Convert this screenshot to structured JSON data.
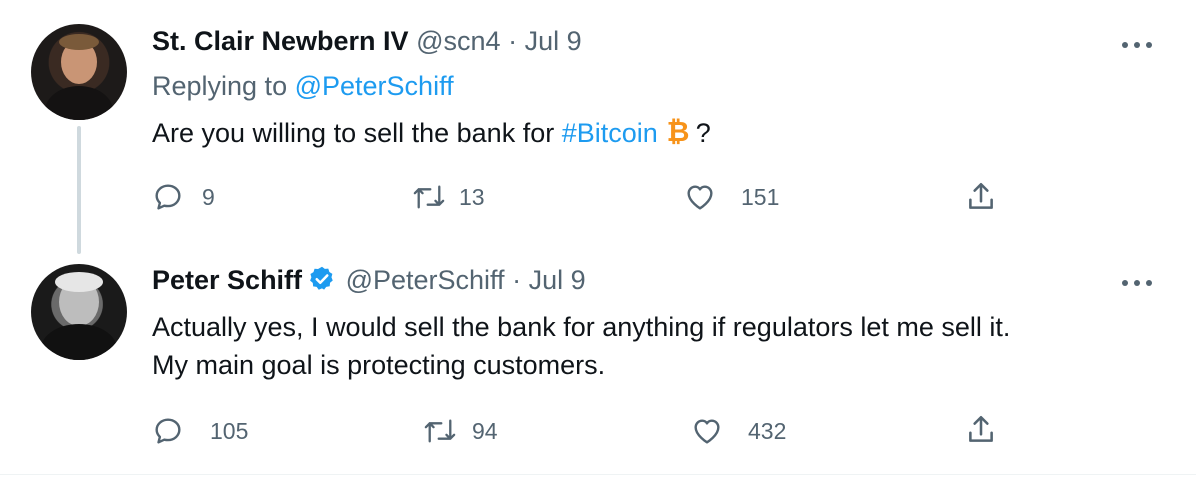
{
  "tweets": [
    {
      "name": "St. Clair Newbern IV",
      "handle": "@scn4",
      "separator": "·",
      "date": "Jul 9",
      "replying_label": "Replying to",
      "replying_to": "@PeterSchiff",
      "text_before": "Are you willing to sell the bank for",
      "hashtag": "#Bitcoin",
      "text_after": "?",
      "verified": false,
      "actions": {
        "replies": "9",
        "retweets": "13",
        "likes": "151"
      }
    },
    {
      "name": "Peter Schiff",
      "handle": "@PeterSchiff",
      "separator": "·",
      "date": "Jul 9",
      "verified": true,
      "text_line1": "Actually yes, I would sell the bank for anything if regulators let me sell it.",
      "text_line2": "My main goal is protecting customers.",
      "actions": {
        "replies": "105",
        "retweets": "94",
        "likes": "432"
      }
    }
  ],
  "colors": {
    "link": "#1d9bf0",
    "muted": "#536471",
    "text": "#0f1419",
    "bitcoin": "#f7931a",
    "thread_line": "#cfd9de"
  },
  "icons": [
    "reply-icon",
    "retweet-icon",
    "like-icon",
    "share-icon",
    "more-icon",
    "verified-icon",
    "bitcoin-icon"
  ]
}
